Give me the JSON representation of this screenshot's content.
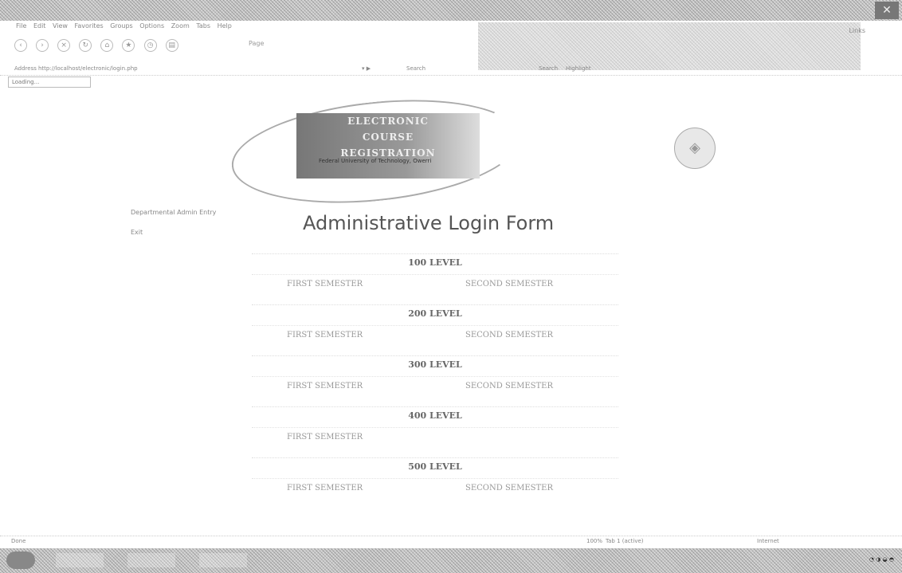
{
  "window": {
    "close_glyph": "✕"
  },
  "menubar": {
    "items": [
      "File",
      "Edit",
      "View",
      "Favorites",
      "Groups",
      "Options",
      "Zoom",
      "Tabs",
      "Help"
    ],
    "right_label": "Links"
  },
  "toolbar": {
    "icons": [
      "back-icon",
      "forward-icon",
      "stop-icon",
      "refresh-icon",
      "home-icon",
      "favorites-icon",
      "history-icon",
      "print-icon"
    ],
    "page_menu": "Page"
  },
  "addressbar": {
    "label": "Address",
    "url": "http://localhost/electronic/login.php",
    "search_label": "Search",
    "search_button": "Search",
    "search_right": "Highlight"
  },
  "tab": {
    "label": "Loading..."
  },
  "logo": {
    "lines": [
      "ELECTRONIC",
      "COURSE",
      "REGISTRATION"
    ],
    "tagline": "Federal University of Technology, Owerri"
  },
  "sidebar": {
    "link1": "Departmental Admin Entry",
    "link2": "Exit"
  },
  "page": {
    "title": "Administrative Login Form"
  },
  "levels": [
    {
      "title": "100 LEVEL",
      "first": "FIRST SEMESTER",
      "second": "SECOND SEMESTER"
    },
    {
      "title": "200 LEVEL",
      "first": "FIRST SEMESTER",
      "second": "SECOND SEMESTER"
    },
    {
      "title": "300 LEVEL",
      "first": "FIRST SEMESTER",
      "second": "SECOND SEMESTER"
    },
    {
      "title": "400 LEVEL",
      "first": "FIRST SEMESTER",
      "second": ""
    },
    {
      "title": "500 LEVEL",
      "first": "FIRST SEMESTER",
      "second": "SECOND SEMESTER"
    }
  ],
  "statusbar": {
    "left": "Done",
    "zoom": "100%",
    "tab_info": "Tab 1 (active)",
    "network": "Internet"
  }
}
